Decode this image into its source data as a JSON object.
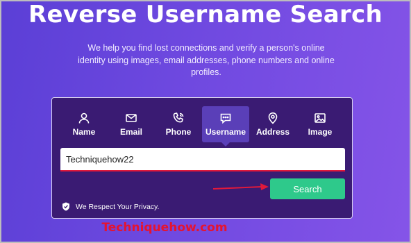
{
  "hero": {
    "title": "Reverse Username Search",
    "subtitle": "We help you find lost connections and verify a person's online identity using images, email addresses, phone numbers and online profiles."
  },
  "tabs": [
    {
      "label": "Name",
      "icon": "person-icon"
    },
    {
      "label": "Email",
      "icon": "envelope-icon"
    },
    {
      "label": "Phone",
      "icon": "phone-icon"
    },
    {
      "label": "Username",
      "icon": "chat-bubble-icon",
      "active": true
    },
    {
      "label": "Address",
      "icon": "map-pin-icon"
    },
    {
      "label": "Image",
      "icon": "image-icon"
    }
  ],
  "search": {
    "value": "Techniquehow22",
    "button_label": "Search"
  },
  "privacy": {
    "text": "We Respect Your Privacy.",
    "icon": "shield-check-icon"
  },
  "watermark": "Techniquehow.com",
  "colors": {
    "card": "#3a1b73",
    "active_tab": "#5a3fb8",
    "button": "#2ec98b",
    "annotation": "#e0193b"
  }
}
